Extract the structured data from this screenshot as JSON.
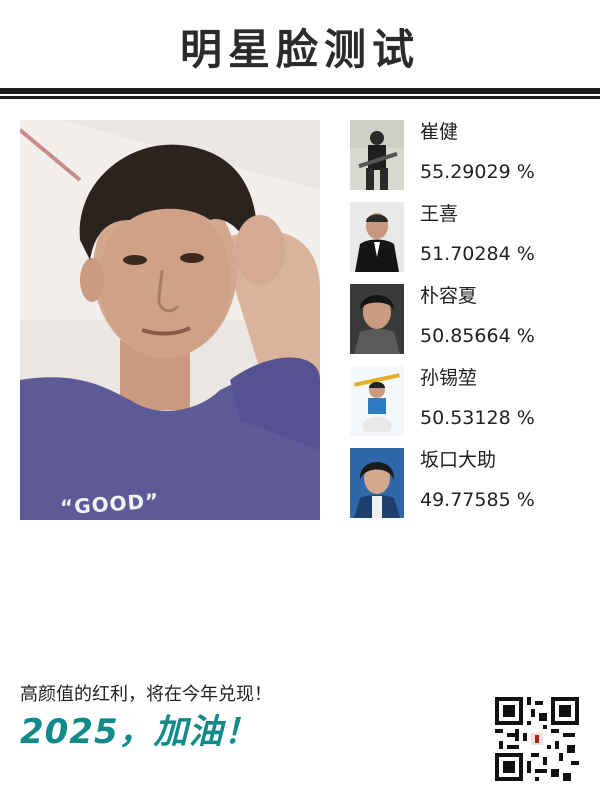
{
  "header": {
    "title": "明星脸测试"
  },
  "matches": [
    {
      "name": "崔健",
      "score": "55.29029 %"
    },
    {
      "name": "王喜",
      "score": "51.70284 %"
    },
    {
      "name": "朴容夏",
      "score": "50.85664 %"
    },
    {
      "name": "孙锡堃",
      "score": "50.53128 %"
    },
    {
      "name": "坂口大助",
      "score": "49.77585 %"
    }
  ],
  "photo": {
    "shirt_text": "“GOOD”"
  },
  "footer": {
    "slogan": "高颜值的红利，将在今年兑现！",
    "cheer": "2025，加油！"
  },
  "colors": {
    "accent": "#138a8a",
    "rule": "#1e1e1e",
    "shirt": "#5e5a98"
  }
}
